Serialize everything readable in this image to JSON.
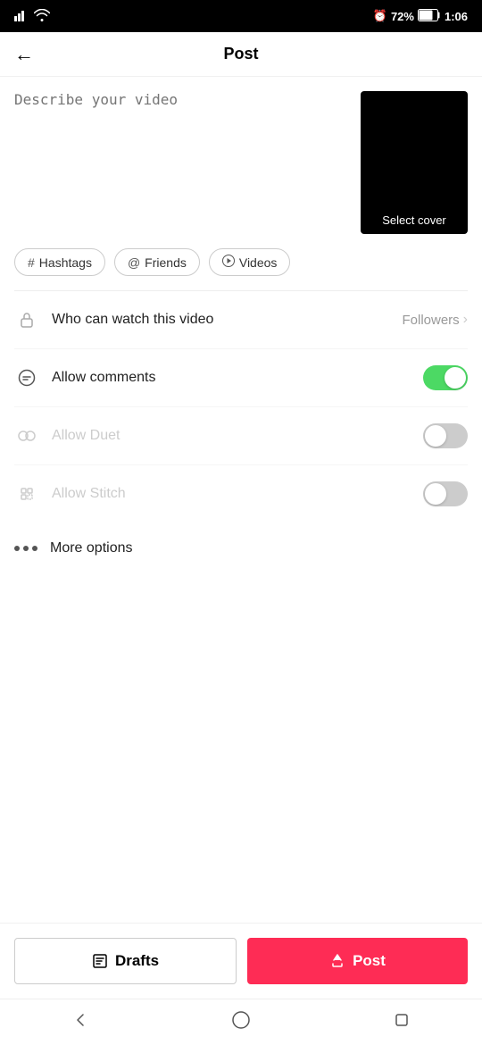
{
  "statusBar": {
    "signal": "▋▋▋",
    "wifi": "WiFi",
    "alarm": "⏰",
    "battery": "72%",
    "time": "1:06"
  },
  "header": {
    "backLabel": "←",
    "title": "Post"
  },
  "videoSection": {
    "placeholder": "Describe your video",
    "selectCoverLabel": "Select cover"
  },
  "tags": [
    {
      "icon": "#",
      "label": "Hashtags"
    },
    {
      "icon": "@",
      "label": "Friends"
    },
    {
      "icon": "▷",
      "label": "Videos"
    }
  ],
  "settings": [
    {
      "id": "who-can-watch",
      "label": "Who can watch this video",
      "value": "Followers",
      "hasChevron": true,
      "hasToggle": false,
      "toggleOn": false,
      "disabled": false
    },
    {
      "id": "allow-comments",
      "label": "Allow comments",
      "value": "",
      "hasChevron": false,
      "hasToggle": true,
      "toggleOn": true,
      "disabled": false
    },
    {
      "id": "allow-duet",
      "label": "Allow Duet",
      "value": "",
      "hasChevron": false,
      "hasToggle": true,
      "toggleOn": false,
      "disabled": true
    },
    {
      "id": "allow-stitch",
      "label": "Allow Stitch",
      "value": "",
      "hasChevron": false,
      "hasToggle": true,
      "toggleOn": false,
      "disabled": true
    }
  ],
  "moreOptions": {
    "label": "More options"
  },
  "bottomBar": {
    "draftsLabel": "Drafts",
    "postLabel": "Post"
  }
}
